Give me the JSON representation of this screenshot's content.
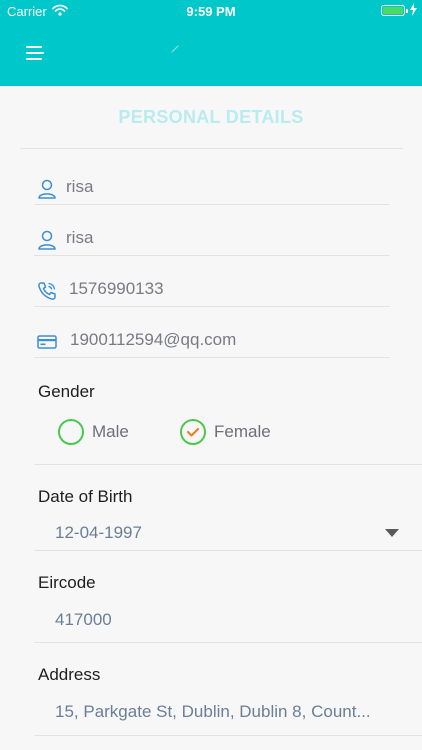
{
  "status_bar": {
    "carrier": "Carrier",
    "time": "9:59 PM"
  },
  "header": {
    "menu_icon": "hamburger-menu-icon",
    "logo_icon": "app-logo-icon"
  },
  "page_title": "PERSONAL DETAILS",
  "fields": {
    "first_name": {
      "icon": "user-icon",
      "value": "risa"
    },
    "last_name": {
      "icon": "user-icon",
      "value": "risa"
    },
    "phone": {
      "icon": "phone-icon",
      "value": "1576990133"
    },
    "email": {
      "icon": "card-icon",
      "value": "1900112594@qq.com"
    }
  },
  "gender": {
    "label": "Gender",
    "options": [
      {
        "label": "Male",
        "selected": false
      },
      {
        "label": "Female",
        "selected": true
      }
    ]
  },
  "date_of_birth": {
    "label": "Date of Birth",
    "value": "12-04-1997"
  },
  "eircode": {
    "label": "Eircode",
    "value": "417000"
  },
  "address": {
    "label": "Address",
    "value": "15, Parkgate St, Dublin, Dublin 8, Count..."
  },
  "colors": {
    "header_bg": "#00c7c9",
    "title": "#b8ecee",
    "radio": "#4cc84f",
    "check": "#e8832a",
    "icon": "#3a8fd6"
  }
}
